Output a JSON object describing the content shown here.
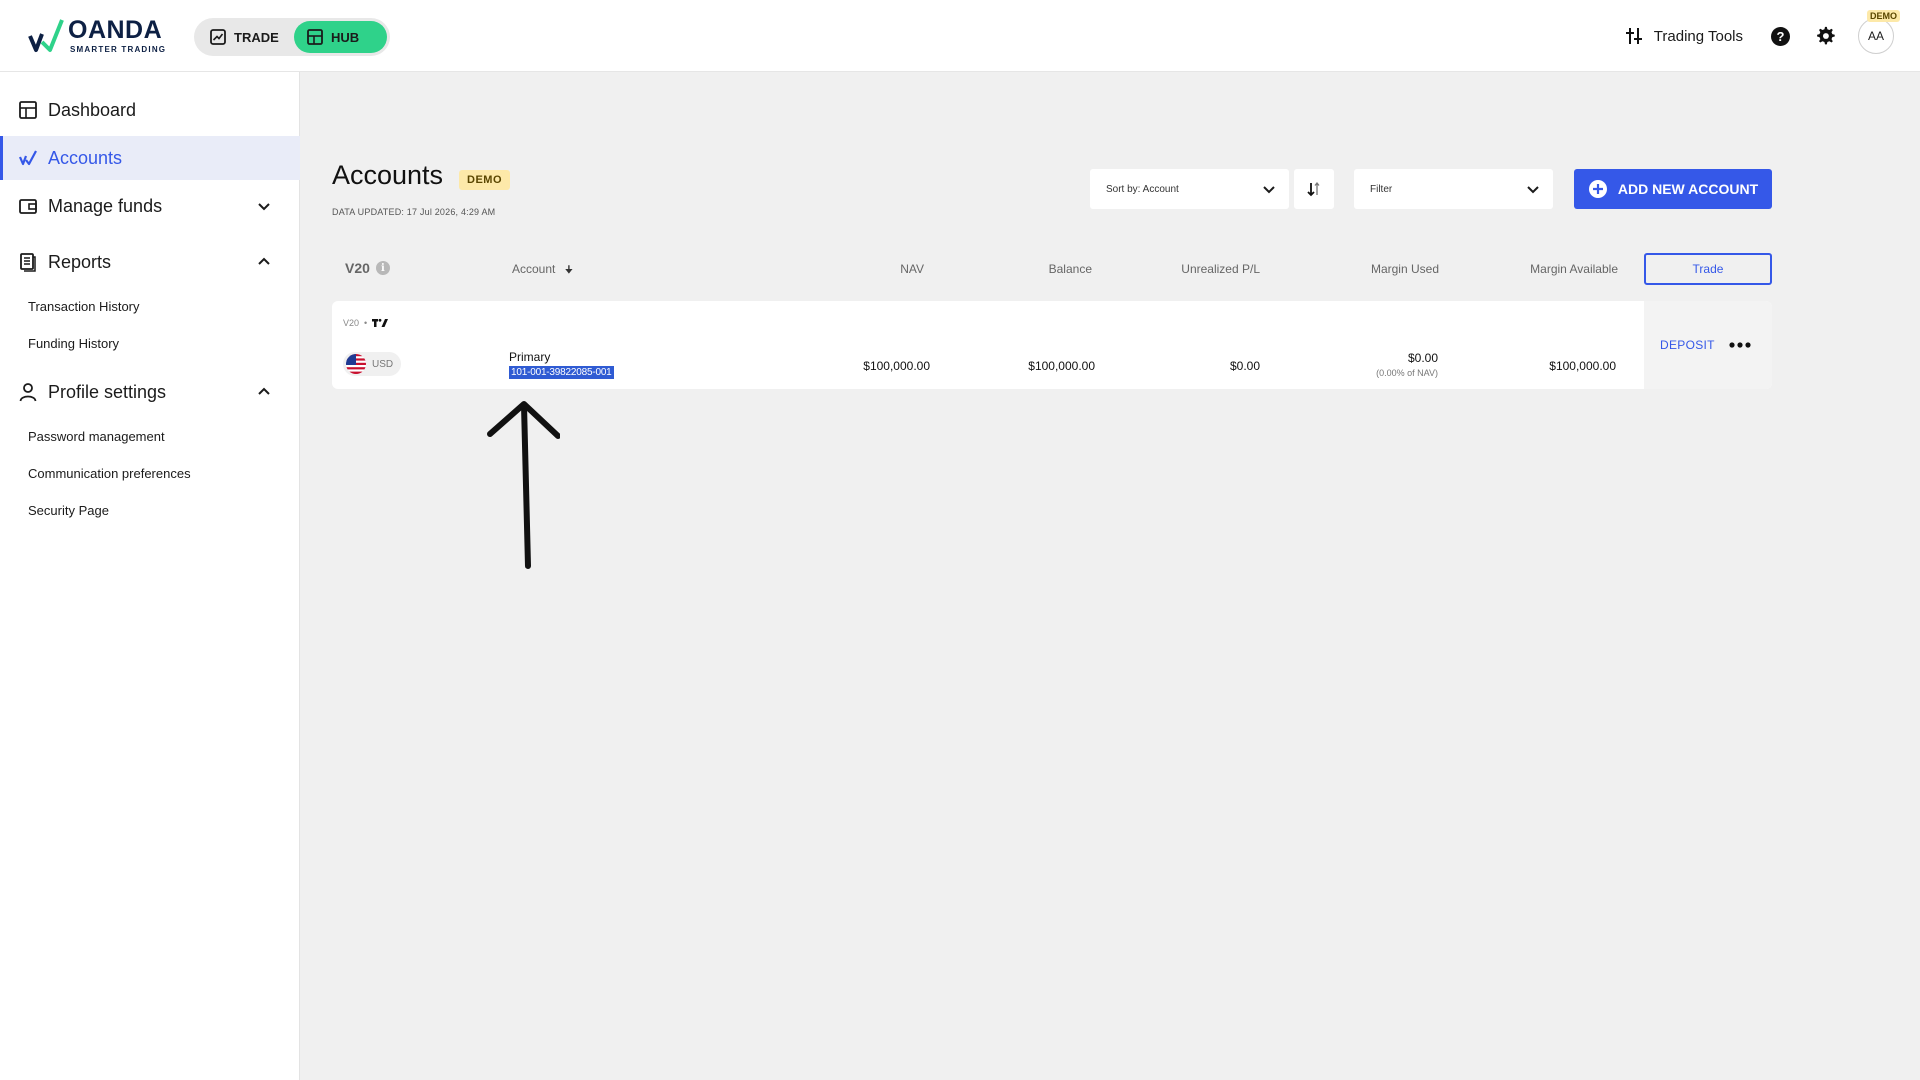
{
  "header": {
    "logo_word": "OANDA",
    "logo_sub": "SMARTER TRADING",
    "switch": {
      "trade_label": "TRADE",
      "hub_label": "HUB",
      "active": "HUB"
    },
    "trading_tools_label": "Trading Tools",
    "help_icon": "question-circle-icon",
    "settings_icon": "gear-icon",
    "avatar_initials": "AA",
    "avatar_badge": "DEMO"
  },
  "sidebar": {
    "items": [
      {
        "label": "Dashboard",
        "icon": "dashboard-icon"
      },
      {
        "label": "Accounts",
        "icon": "accounts-icon",
        "active": true
      },
      {
        "label": "Manage funds",
        "icon": "wallet-icon",
        "expanded": false
      },
      {
        "label": "Reports",
        "icon": "reports-icon",
        "expanded": true,
        "children": [
          "Transaction History",
          "Funding History"
        ]
      },
      {
        "label": "Profile settings",
        "icon": "user-icon",
        "expanded": true,
        "children": [
          "Password management",
          "Communication preferences",
          "Security Page"
        ]
      }
    ]
  },
  "main": {
    "title": "Accounts",
    "title_badge": "DEMO",
    "data_updated": "DATA UPDATED: 17 Jul 2026, 4:29 AM",
    "sort_select": {
      "value": "Sort by: Account"
    },
    "filter_select": {
      "value": "Filter"
    },
    "add_button_label": "ADD NEW ACCOUNT",
    "table": {
      "group_label": "V20",
      "headers": {
        "account": "Account",
        "nav": "NAV",
        "balance": "Balance",
        "unrealized": "Unrealized P/L",
        "margin_used": "Margin Used",
        "margin_available": "Margin Available",
        "trade": "Trade"
      },
      "rows": [
        {
          "platform": "V20",
          "currency": "USD",
          "name": "Primary",
          "id": "101-001-39822085-001",
          "nav": "$100,000.00",
          "balance": "$100,000.00",
          "unrealized": "$0.00",
          "margin_used": "$0.00",
          "margin_used_pct": "(0.00% of NAV)",
          "margin_available": "$100,000.00",
          "action_label": "DEPOSIT"
        }
      ]
    }
  },
  "colors": {
    "accent": "#3558e8",
    "hub_green": "#2fd28a",
    "demo_badge": "#fde9a9",
    "selection": "#2f5bd3"
  }
}
